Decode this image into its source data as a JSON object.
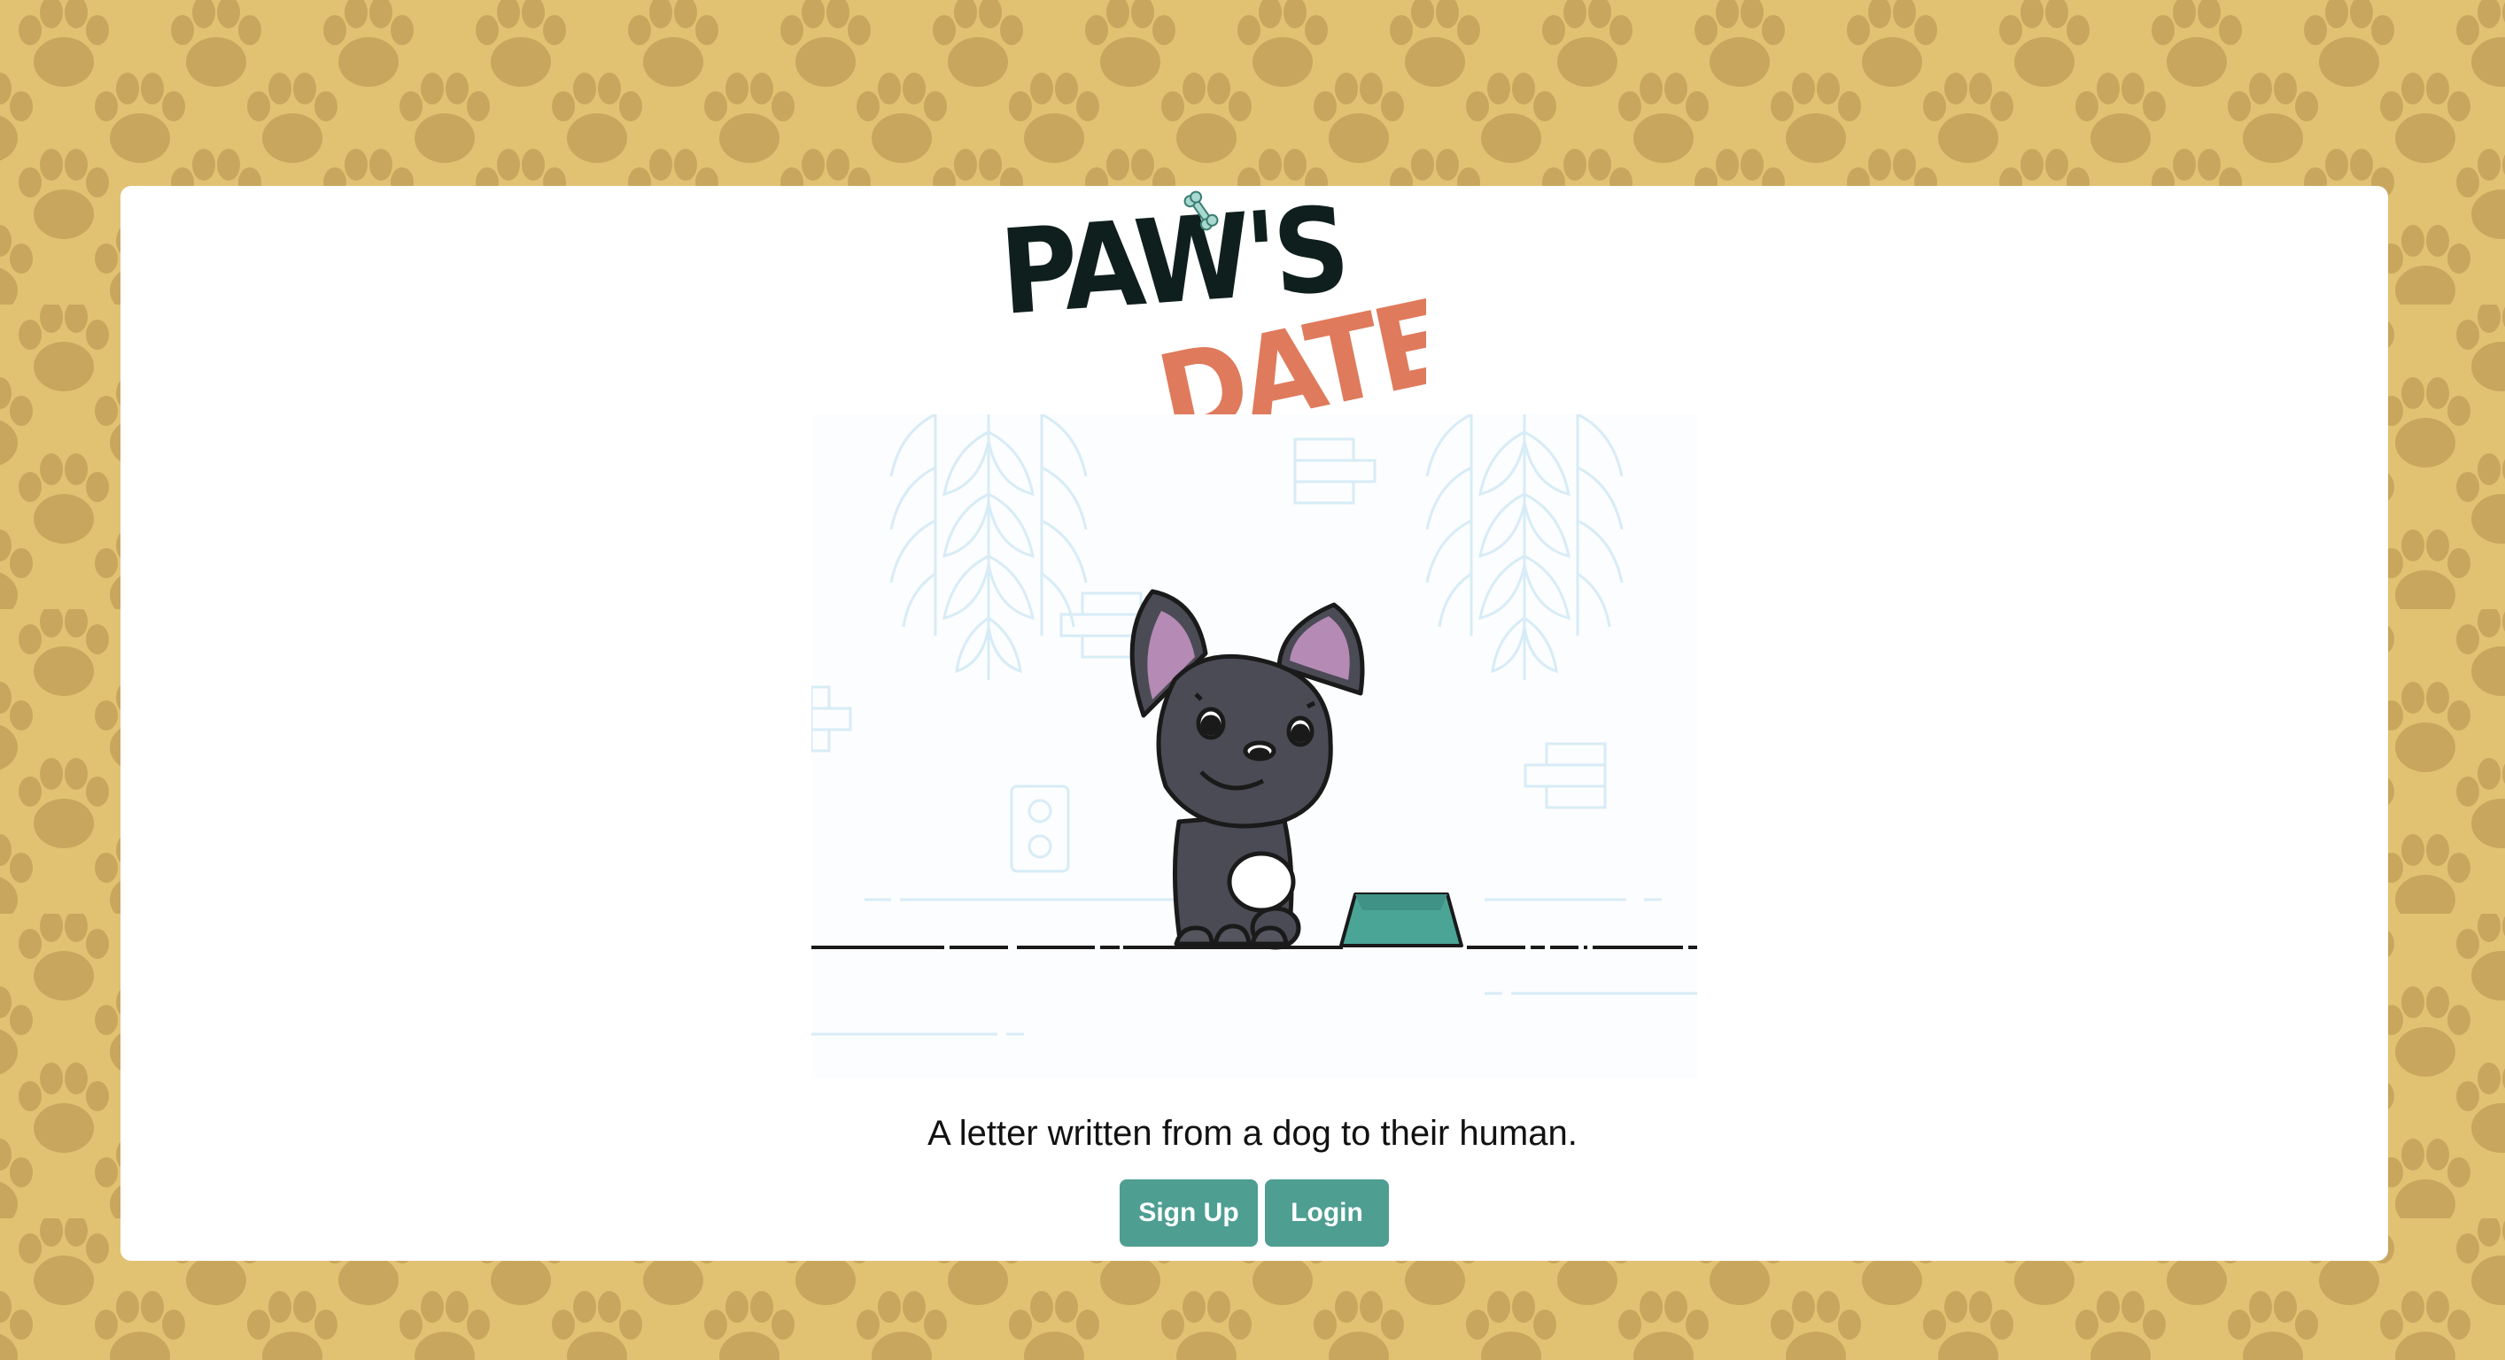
{
  "page": {
    "background_color": "#e1c272",
    "pattern_color": "#c9a65e",
    "pattern_icon": "paw-print-icon"
  },
  "logo": {
    "word1": "PAW'S",
    "word2": "DATE",
    "word1_color": "#0f1f1d",
    "word2_color": "#df7a5c",
    "accent_icon": "bone-icon"
  },
  "illustration": {
    "subject": "french-bulldog-with-food-bowl"
  },
  "tagline": "A letter written from a dog to their human.",
  "buttons": {
    "signup_label": "Sign Up",
    "login_label": "Login",
    "color": "#4e9e92"
  }
}
